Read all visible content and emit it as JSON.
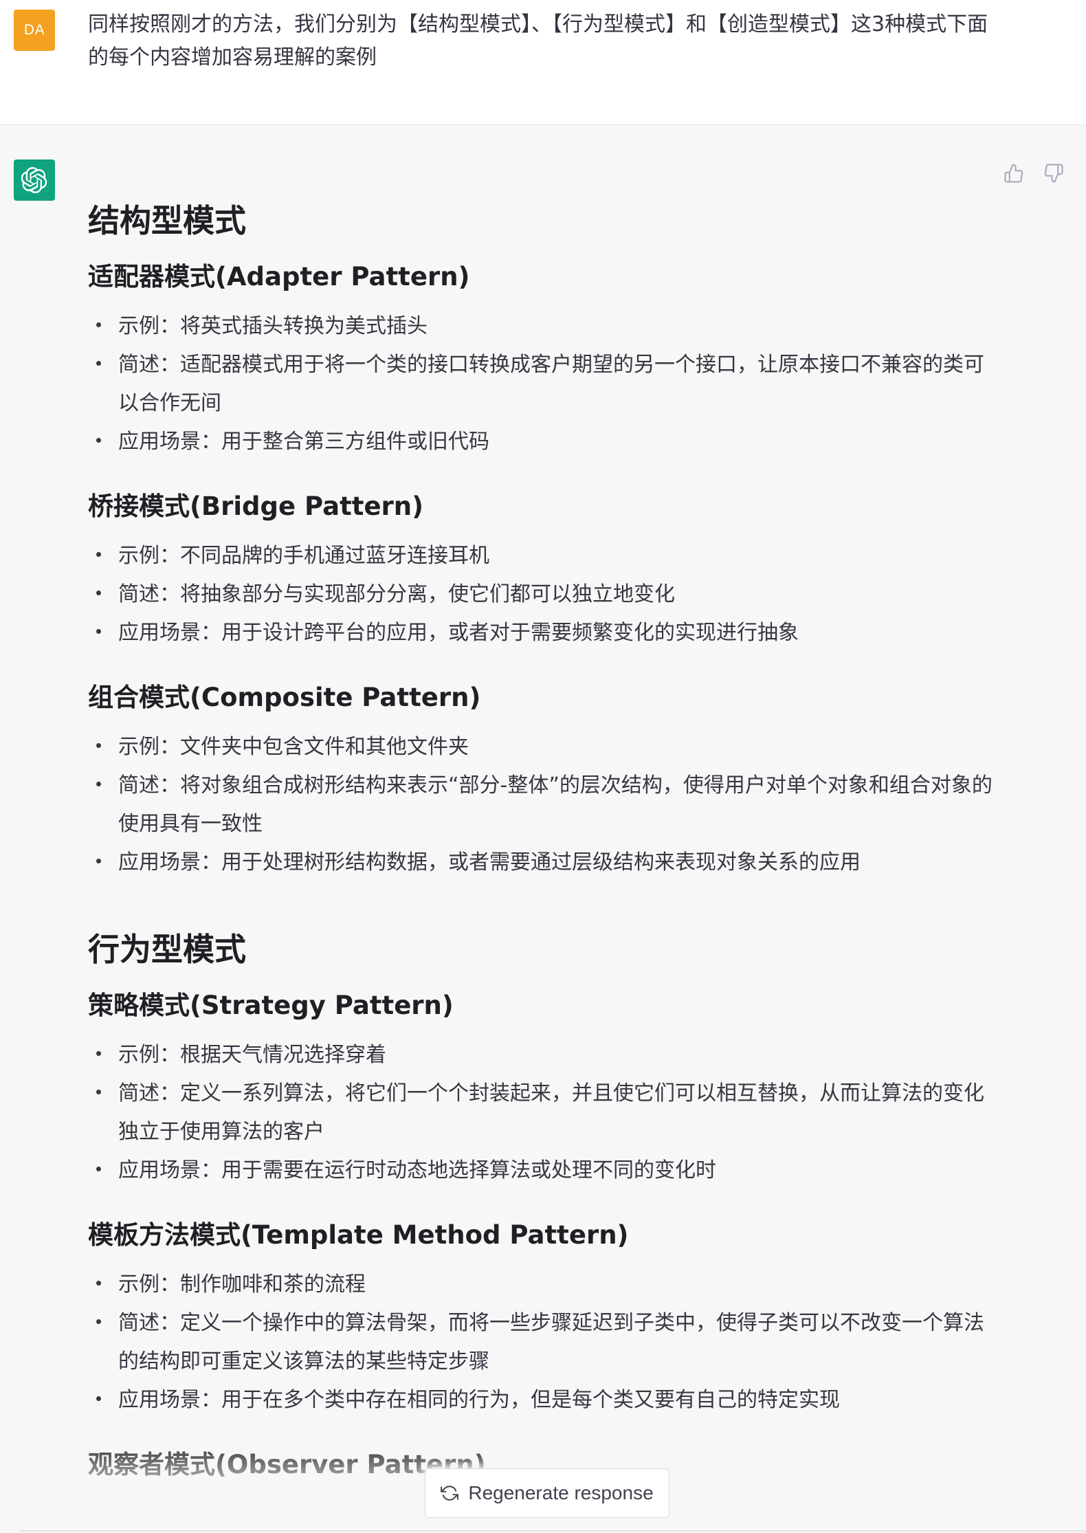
{
  "user": {
    "avatar_initials": "DA",
    "message": "同样按照刚才的方法，我们分别为【结构型模式】、【行为型模式】和【创造型模式】这3种模式下面的每个内容增加容易理解的案例"
  },
  "assistant": {
    "avatar_icon": "openai-logo-icon",
    "feedback": {
      "thumbs_up_icon": "thumbs-up-icon",
      "thumbs_down_icon": "thumbs-down-icon"
    },
    "sections": [
      {
        "title": "结构型模式",
        "patterns": [
          {
            "name": "适配器模式(Adapter Pattern)",
            "items": [
              "示例：将英式插头转换为美式插头",
              "简述：适配器模式用于将一个类的接口转换成客户期望的另一个接口，让原本接口不兼容的类可以合作无间",
              "应用场景：用于整合第三方组件或旧代码"
            ]
          },
          {
            "name": "桥接模式(Bridge Pattern)",
            "items": [
              "示例：不同品牌的手机通过蓝牙连接耳机",
              "简述：将抽象部分与实现部分分离，使它们都可以独立地变化",
              "应用场景：用于设计跨平台的应用，或者对于需要频繁变化的实现进行抽象"
            ]
          },
          {
            "name": "组合模式(Composite Pattern)",
            "items": [
              "示例：文件夹中包含文件和其他文件夹",
              "简述：将对象组合成树形结构来表示“部分-整体”的层次结构，使得用户对单个对象和组合对象的使用具有一致性",
              "应用场景：用于处理树形结构数据，或者需要通过层级结构来表现对象关系的应用"
            ]
          }
        ]
      },
      {
        "title": "行为型模式",
        "patterns": [
          {
            "name": "策略模式(Strategy Pattern)",
            "items": [
              "示例：根据天气情况选择穿着",
              "简述：定义一系列算法，将它们一个个封装起来，并且使它们可以相互替换，从而让算法的变化独立于使用算法的客户",
              "应用场景：用于需要在运行时动态地选择算法或处理不同的变化时"
            ]
          },
          {
            "name": "模板方法模式(Template Method Pattern)",
            "items": [
              "示例：制作咖啡和茶的流程",
              "简述：定义一个操作中的算法骨架，而将一些步骤延迟到子类中，使得子类可以不改变一个算法的结构即可重定义该算法的某些特定步骤",
              "应用场景：用于在多个类中存在相同的行为，但是每个类又要有自己的特定实现"
            ]
          },
          {
            "name": "观察者模式(Observer Pattern)",
            "items": []
          }
        ]
      }
    ],
    "regenerate_label": "Regenerate response",
    "regenerate_icon": "refresh-icon"
  }
}
